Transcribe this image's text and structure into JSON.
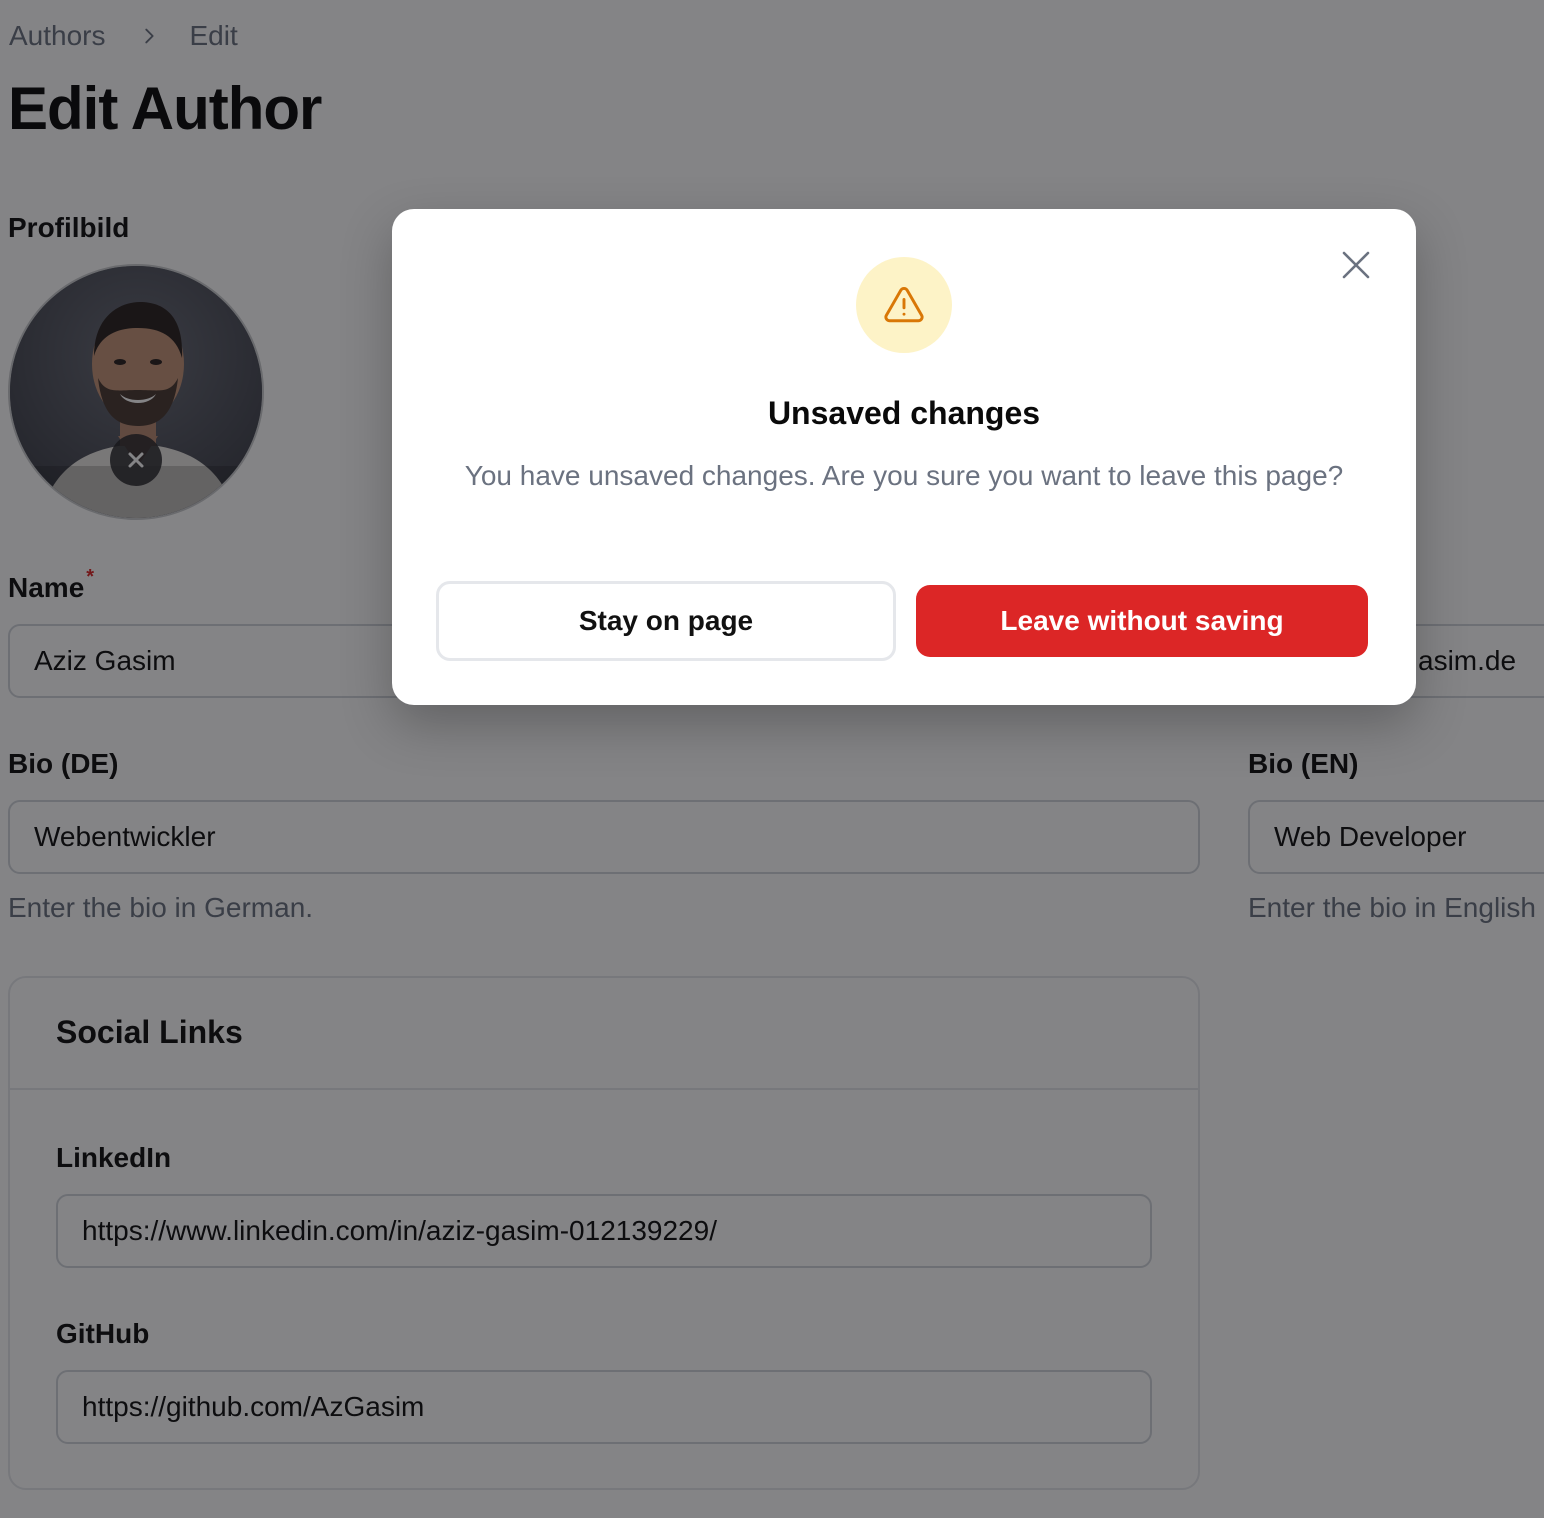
{
  "breadcrumb": {
    "items": [
      "Authors",
      "Edit"
    ]
  },
  "page_title": "Edit Author",
  "profile_image": {
    "label": "Profilbild"
  },
  "name": {
    "label": "Name",
    "required_mark": "*",
    "value": "Aziz Gasim"
  },
  "email": {
    "value_visible": "asim.de"
  },
  "bio_de": {
    "label": "Bio (DE)",
    "value": "Webentwickler",
    "helper": "Enter the bio in German."
  },
  "bio_en": {
    "label": "Bio (EN)",
    "value": "Web Developer",
    "helper": "Enter the bio in English"
  },
  "social_links": {
    "title": "Social Links",
    "linkedin": {
      "label": "LinkedIn",
      "value": "https://www.linkedin.com/in/aziz-gasim-012139229/"
    },
    "github": {
      "label": "GitHub",
      "value": "https://github.com/AzGasim"
    }
  },
  "modal": {
    "title": "Unsaved changes",
    "message": "You have unsaved changes. Are you sure you want to leave this page?",
    "stay_label": "Stay on page",
    "leave_label": "Leave without saving",
    "icon": "warning-triangle-icon"
  },
  "colors": {
    "danger": "#dc2626",
    "warning_bg": "#fdf3c7",
    "warning_icon": "#d97706"
  }
}
